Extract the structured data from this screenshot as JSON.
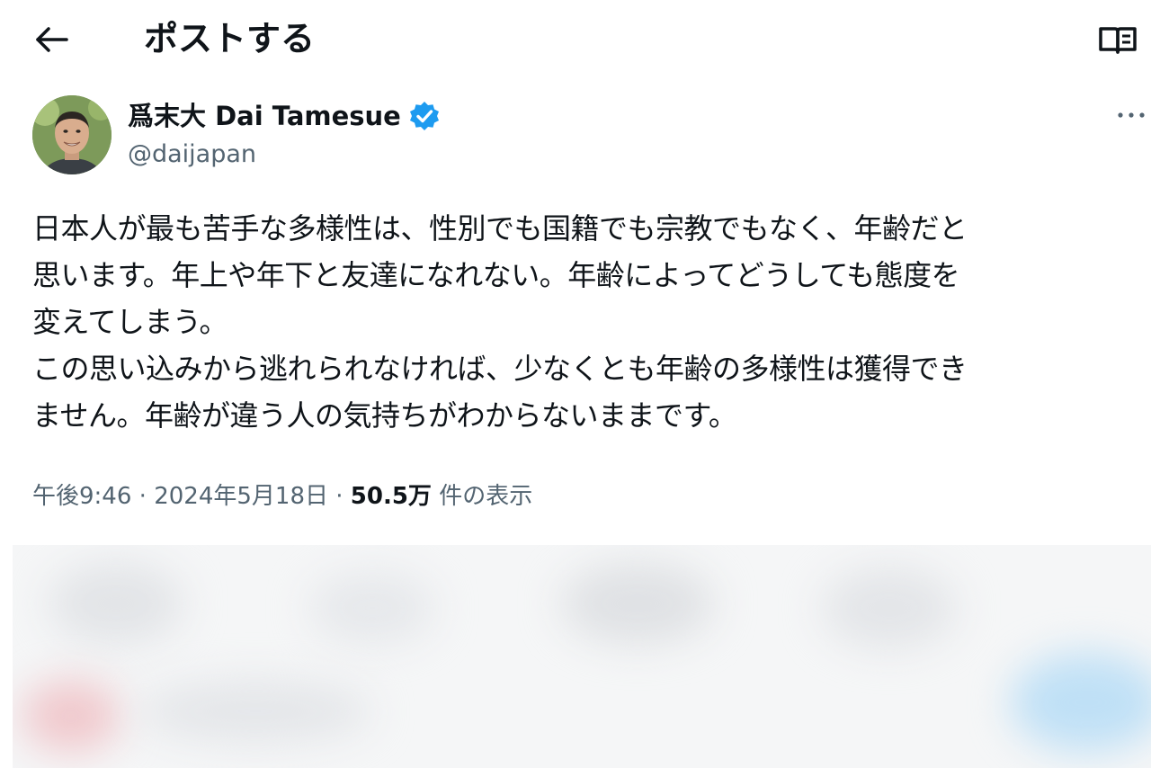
{
  "header": {
    "title": "ポストする",
    "back_icon": "arrow-left-icon",
    "reader_icon": "book-open-icon"
  },
  "author": {
    "display_name": "爲末大 Dai Tamesue",
    "handle": "@daijapan",
    "verified": true,
    "verified_color": "#1d9bf0"
  },
  "post": {
    "text_lines": [
      "日本人が最も苦手な多様性は、性別でも国籍でも宗教でもなく、年齢だと",
      "思います。年上や年下と友達になれない。年齢によってどうしても態度を",
      "変えてしまう。",
      "この思い込みから逃れられなければ、少なくとも年齢の多様性は獲得でき",
      "ません。年齢が違う人の気持ちがわからないままです。"
    ]
  },
  "meta": {
    "time": "午後9:46",
    "separator": "·",
    "date": "2024年5月18日",
    "views_count": "50.5万",
    "views_label": "件の表示"
  },
  "colors": {
    "text_primary": "#0f1419",
    "text_secondary": "#536471",
    "accent": "#1d9bf0"
  }
}
